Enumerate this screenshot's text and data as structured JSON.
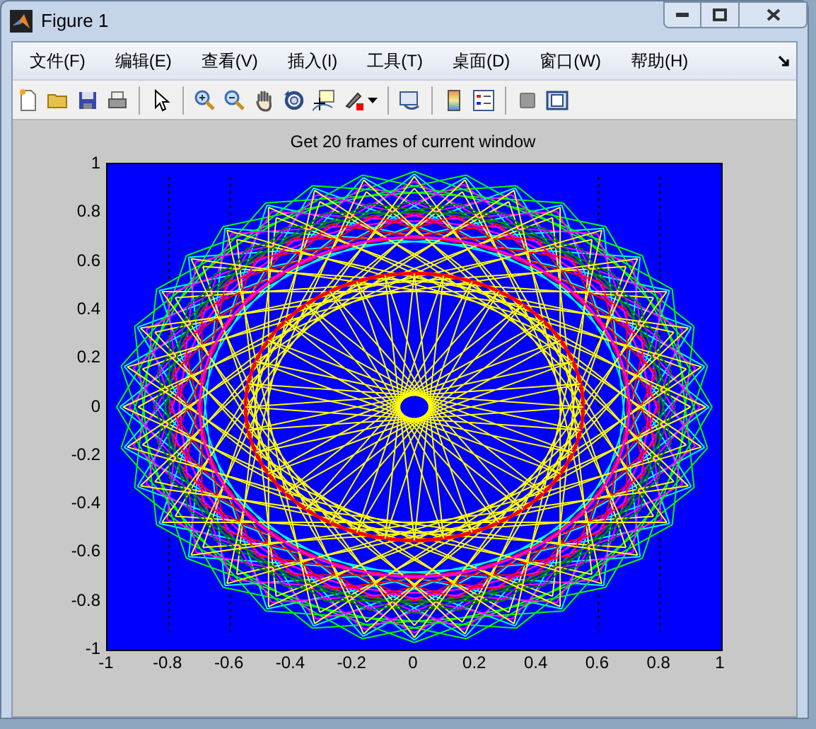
{
  "window": {
    "title": "Figure 1"
  },
  "menu": [
    "文件(F)",
    "编辑(E)",
    "查看(V)",
    "插入(I)",
    "工具(T)",
    "桌面(D)",
    "窗口(W)",
    "帮助(H)"
  ],
  "toolbar": [
    {
      "kind": "new"
    },
    {
      "kind": "open"
    },
    {
      "kind": "save"
    },
    {
      "kind": "print"
    },
    {
      "kind": "separator"
    },
    {
      "kind": "pointer"
    },
    {
      "kind": "separator"
    },
    {
      "kind": "zoom-in"
    },
    {
      "kind": "zoom-out"
    },
    {
      "kind": "pan"
    },
    {
      "kind": "rotate"
    },
    {
      "kind": "datatip"
    },
    {
      "kind": "brush"
    },
    {
      "kind": "separator"
    },
    {
      "kind": "link"
    },
    {
      "kind": "separator"
    },
    {
      "kind": "colorbar"
    },
    {
      "kind": "legend"
    },
    {
      "kind": "separator"
    },
    {
      "kind": "square"
    },
    {
      "kind": "plot-tools"
    }
  ],
  "axes": {
    "title": "Get 20 frames of current window",
    "xtick_labels": [
      "-1",
      "-0.8",
      "-0.6",
      "-0.4",
      "-0.2",
      "0",
      "0.2",
      "0.4",
      "0.6",
      "0.8",
      "1"
    ],
    "ytick_labels": [
      "1",
      "0.8",
      "0.6",
      "0.4",
      "0.2",
      "0",
      "-0.2",
      "-0.4",
      "-0.6",
      "-0.8",
      "-1"
    ]
  }
}
